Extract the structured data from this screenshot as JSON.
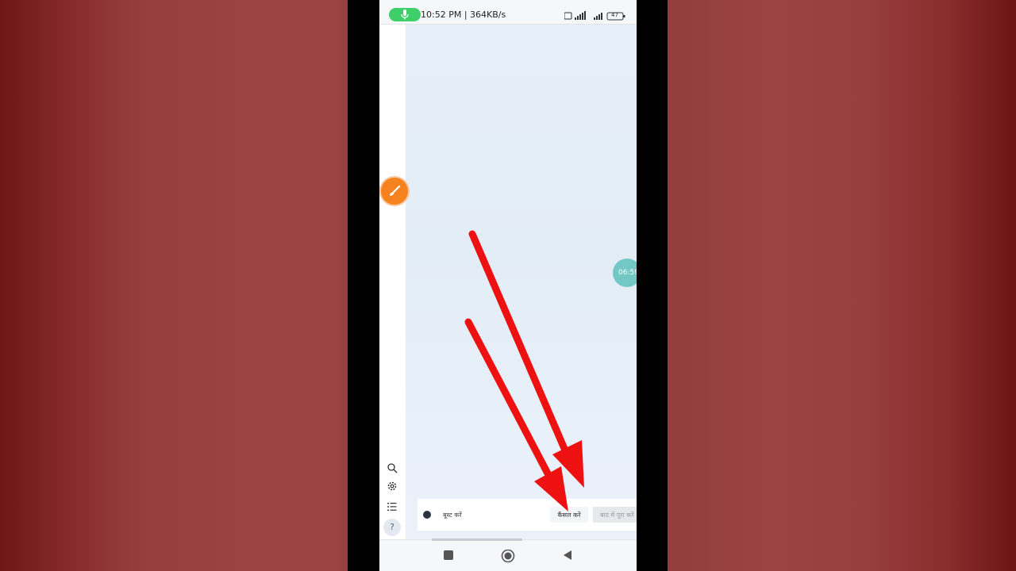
{
  "status_bar": {
    "time_speed": "10:52 PM | 364KB/s",
    "battery": "47",
    "mic_icon": "microphone-icon"
  },
  "sidebar": {
    "fab_icon": "paintbrush-icon",
    "icons": [
      "search-icon",
      "gear-icon",
      "list-icon",
      "help-icon"
    ],
    "help_label": "?"
  },
  "content": {
    "timer_bubble": "06:59"
  },
  "bottom_bar": {
    "toggle_label": "बूस्ट करें",
    "toggle_on": false,
    "cancel_label": "कैंसल करें",
    "later_label": "बाद में पूरा करें"
  },
  "nav_bar": {
    "icons": [
      "recents-square-icon",
      "home-circle-icon",
      "back-triangle-icon"
    ]
  },
  "colors": {
    "annotation_arrow": "#ee1111",
    "fab": "#f6821f",
    "mic_pill": "#3ecf6a",
    "timer": "#6ec7c4"
  }
}
